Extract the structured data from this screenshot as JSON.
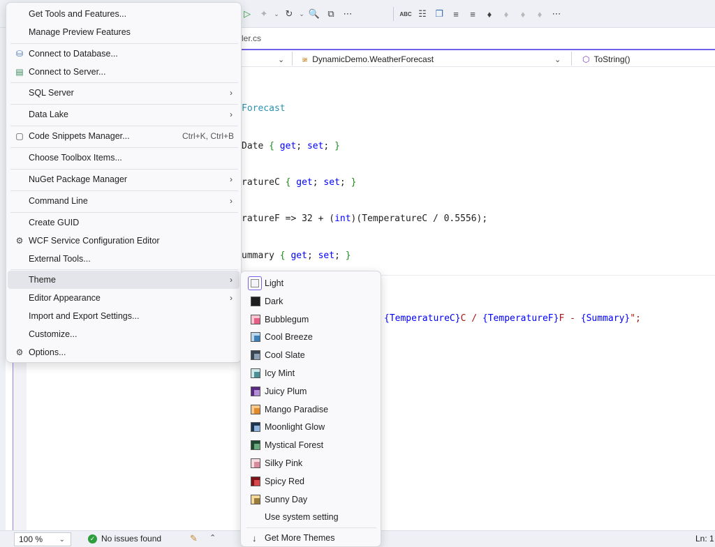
{
  "document_tab": {
    "label": "ler.cs"
  },
  "navbar": {
    "class_label": "DynamicDemo.WeatherForecast",
    "member_label": "ToString()"
  },
  "code": {
    "l1_type": "Forecast",
    "l2_name": "Date ",
    "l3_name": "ratureC ",
    "l4_a": "ratureF => 32 + (",
    "l4_kw": "int",
    "l4_b": ")(TemperatureC / 0.5556);",
    "l5_name": "ummary ",
    "l6_a": "{TemperatureC}",
    "l6_b": "C / ",
    "l6_c": "{TemperatureF}",
    "l6_d": "F - ",
    "l6_e": "{Summary}",
    "l6_f": "\";",
    "brace_open": "{",
    "brace_close": "}",
    "get": "get",
    "set": "set",
    "semi": ";"
  },
  "menu": {
    "get_tools": "Get Tools and Features...",
    "manage_preview": "Manage Preview Features",
    "connect_db": "Connect to Database...",
    "connect_server": "Connect to Server...",
    "sql_server": "SQL Server",
    "data_lake": "Data Lake",
    "code_snippets": "Code Snippets Manager...",
    "code_snippets_shortcut": "Ctrl+K, Ctrl+B",
    "choose_toolbox": "Choose Toolbox Items...",
    "nuget": "NuGet Package Manager",
    "command_line": "Command Line",
    "create_guid": "Create GUID",
    "wcf_editor": "WCF Service Configuration Editor",
    "external_tools": "External Tools...",
    "theme": "Theme",
    "editor_appearance": "Editor Appearance",
    "import_export": "Import and Export Settings...",
    "customize": "Customize...",
    "options": "Options..."
  },
  "themes": {
    "items": [
      {
        "label": "Light",
        "outer": "#ffffff",
        "inner": "#f4f4f8"
      },
      {
        "label": "Dark",
        "outer": "#1e1e1e",
        "inner": "#1e1e1e"
      },
      {
        "label": "Bubblegum",
        "outer": "#f7c6d3",
        "inner": "#e35f87"
      },
      {
        "label": "Cool Breeze",
        "outer": "#b9d6ea",
        "inner": "#3f7fb8"
      },
      {
        "label": "Cool Slate",
        "outer": "#3a4654",
        "inner": "#8ea0b4"
      },
      {
        "label": "Icy Mint",
        "outer": "#cfe8ea",
        "inner": "#4e8f95"
      },
      {
        "label": "Juicy Plum",
        "outer": "#5b2a83",
        "inner": "#b38fd6"
      },
      {
        "label": "Mango Paradise",
        "outer": "#f5c88f",
        "inner": "#e08a2c"
      },
      {
        "label": "Moonlight Glow",
        "outer": "#1f3653",
        "inner": "#8fb3dc"
      },
      {
        "label": "Mystical Forest",
        "outer": "#1f4a2f",
        "inner": "#6aa87f"
      },
      {
        "label": "Silky Pink",
        "outer": "#f6dbe1",
        "inner": "#d68a9b"
      },
      {
        "label": "Spicy Red",
        "outer": "#7d1518",
        "inner": "#d8474c"
      },
      {
        "label": "Sunny Day",
        "outer": "#f3d99a",
        "inner": "#9b7b3a"
      }
    ],
    "use_system": "Use system setting",
    "get_more": "Get More Themes"
  },
  "status": {
    "zoom": "100 %",
    "issues": "No issues found",
    "position": "Ln: 1"
  },
  "colors": {
    "accent": "#7160e8",
    "ok": "#2e9d3e"
  }
}
